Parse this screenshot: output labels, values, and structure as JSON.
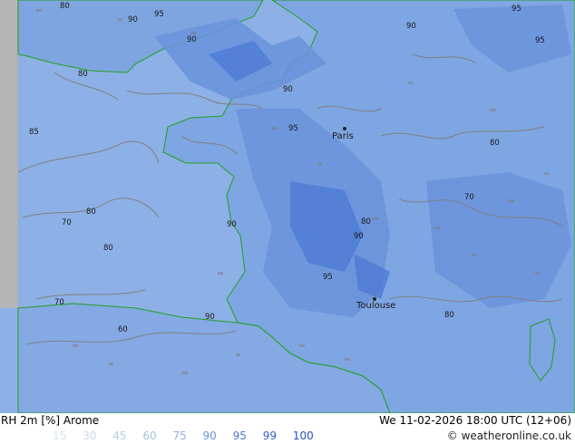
{
  "footer": {
    "product": "RH 2m [%] Arome",
    "valid_time": "We 11-02-2026 18:00 UTC (12+06)",
    "copyright": "© weatheronline.co.uk"
  },
  "legend": [
    {
      "value": "15",
      "color": "#d8e4ee"
    },
    {
      "value": "30",
      "color": "#c8d8e8"
    },
    {
      "value": "45",
      "color": "#b8cde3"
    },
    {
      "value": "60",
      "color": "#a5c3e6"
    },
    {
      "value": "75",
      "color": "#8eb1e2"
    },
    {
      "value": "90",
      "color": "#6b94db"
    },
    {
      "value": "95",
      "color": "#4a79d3"
    },
    {
      "value": "99",
      "color": "#3463c9"
    },
    {
      "value": "100",
      "color": "#2350bd"
    }
  ],
  "colors": {
    "sea": "#8db1e6",
    "land": "#80a7e2",
    "coast": "#21a021",
    "contour_gray": "#7f7f7f",
    "left_strip": "#b4b4b4"
  },
  "cities": [
    "Paris",
    "Toulouse"
  ],
  "contour_values": [
    "80",
    "90",
    "95",
    "80",
    "90",
    "85",
    "70",
    "80",
    "90",
    "95",
    "90",
    "80",
    "80",
    "90",
    "95",
    "70",
    "80",
    "60",
    "70",
    "90",
    "80",
    "95",
    "90",
    "95"
  ]
}
